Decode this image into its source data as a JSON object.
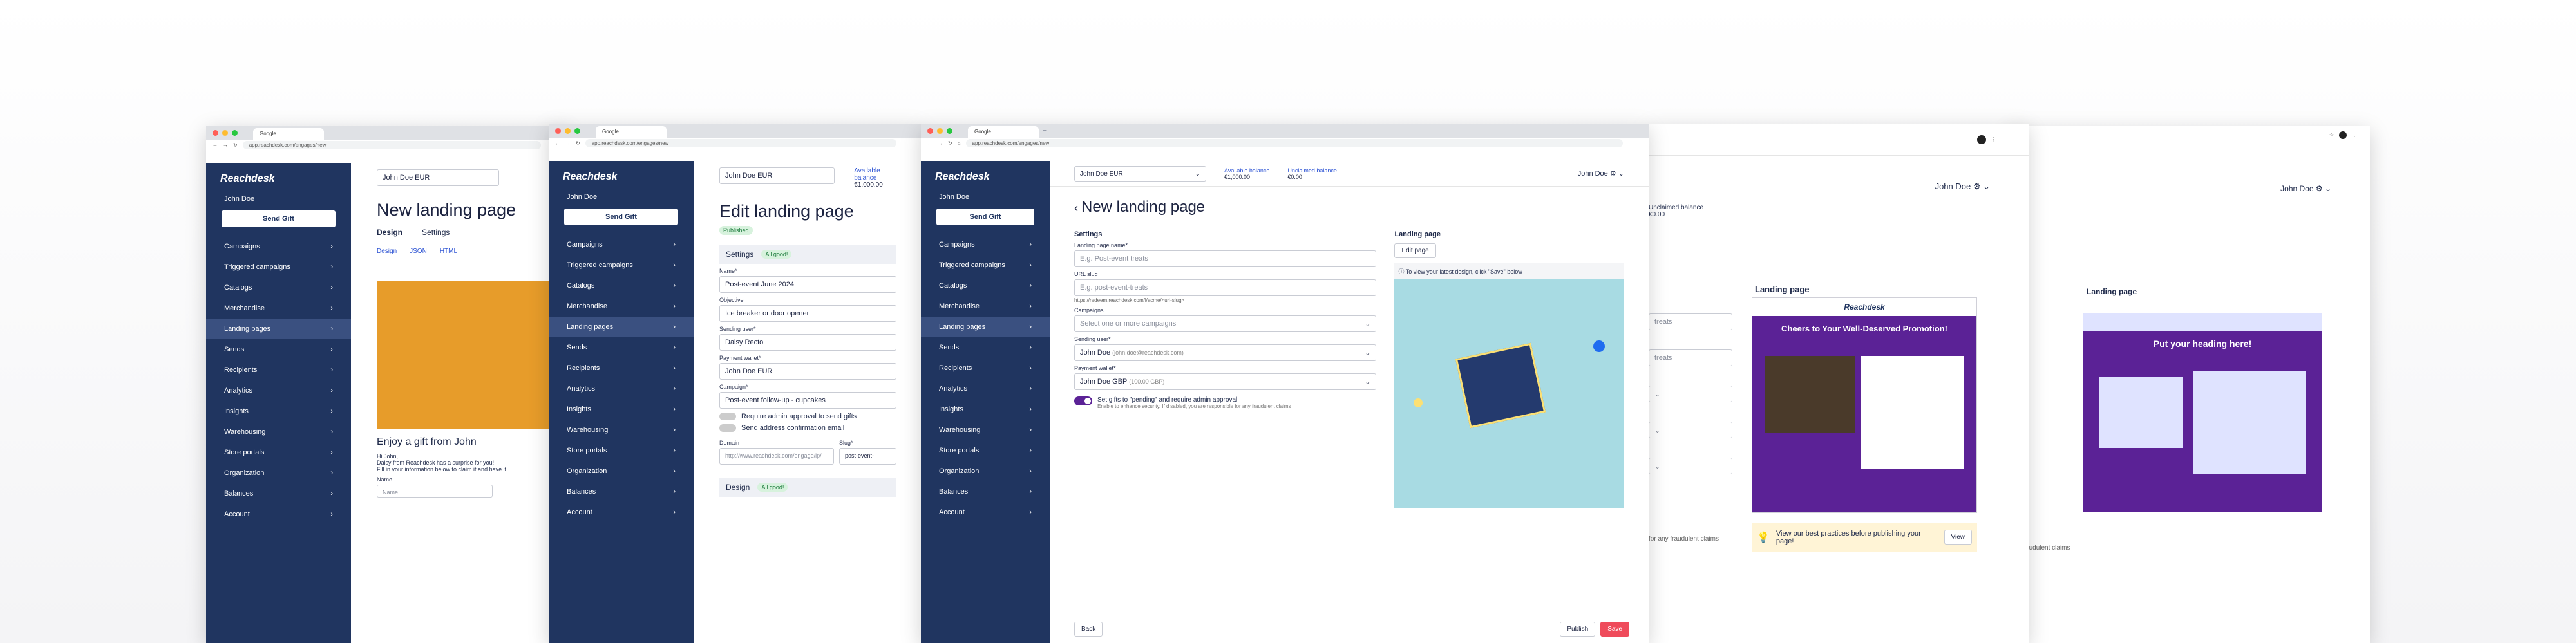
{
  "browser": {
    "tab_title": "Google",
    "url_new": "app.reachdesk.com/engages/new"
  },
  "sidebar": {
    "logo": "Reachdesk",
    "user": "John Doe",
    "send_gift": "Send Gift",
    "items": [
      {
        "label": "Campaigns"
      },
      {
        "label": "Triggered campaigns"
      },
      {
        "label": "Catalogs"
      },
      {
        "label": "Merchandise"
      },
      {
        "label": "Landing pages"
      },
      {
        "label": "Sends"
      },
      {
        "label": "Recipients"
      },
      {
        "label": "Analytics"
      },
      {
        "label": "Insights"
      },
      {
        "label": "Warehousing"
      },
      {
        "label": "Store portals"
      },
      {
        "label": "Organization"
      },
      {
        "label": "Balances"
      },
      {
        "label": "Account"
      }
    ]
  },
  "left1": {
    "select": "John Doe EUR",
    "title": "New landing page",
    "tab_design": "Design",
    "tab_settings": "Settings",
    "greeting": "Enjoy a gift from John",
    "hi": "Hi John,",
    "body1": "Daisy from Reachdesk has a surprise for you!",
    "body2": "Fill in your information below to claim it and have it",
    "name_label": "Name",
    "name_ph": "Name",
    "json": "JSON",
    "html": "HTML",
    "design_link": "Design"
  },
  "left2": {
    "select": "John Doe EUR",
    "title": "Edit landing page",
    "status": "Published",
    "settings": "Settings",
    "all_good": "All good!",
    "available": "Available balance",
    "available_amt": "€1,000.00",
    "name_label": "Name*",
    "name_val": "Post-event June 2024",
    "objective_label": "Objective",
    "objective_val": "Ice breaker or door opener",
    "sending_label": "Sending user*",
    "sending_val": "Daisy Recto",
    "payment_label": "Payment wallet*",
    "payment_val": "John Doe EUR",
    "campaign_label": "Campaign*",
    "campaign_val": "Post-event follow-up - cupcakes",
    "admin": "Require admin approval to send gifts",
    "address": "Send address confirmation email",
    "domain_label": "Domain",
    "domain_val": "http://www.reachdesk.com/engage/lp/",
    "slug_label": "Slug*",
    "slug_val": "post-event-",
    "design": "Design"
  },
  "center": {
    "wallet": "John Doe EUR",
    "avail_label": "Available balance",
    "avail_amt": "€1,000.00",
    "unclaimed_label": "Unclaimed balance",
    "unclaimed_amt": "€0.00",
    "user": "John Doe",
    "title": "New landing page",
    "settings": "Settings",
    "landing_page": "Landing page",
    "name_label": "Landing page name*",
    "name_ph": "E.g. Post-event treats",
    "url_label": "URL slug",
    "url_ph": "E.g. post-event-treats",
    "url_hint": "https://redeem.reachdesk.com/l/acme/<url-slug>",
    "campaigns_label": "Campaigns",
    "campaigns_ph": "Select one or more campaigns",
    "sending_label": "Sending user*",
    "sending_val": "John Doe",
    "sending_email": "(john.doe@reachdesk.com)",
    "payment_label": "Payment wallet*",
    "payment_val": "John Doe GBP",
    "payment_amt": "(100.00 GBP)",
    "toggle_label": "Set gifts to \"pending\" and require admin approval",
    "toggle_hint": "Enable to enhance security. If disabled, you are responsible for any fraudulent claims",
    "edit_page": "Edit page",
    "info": "To view your latest design, click \"Save\" below",
    "back": "Back",
    "publish": "Publish",
    "save": "Save"
  },
  "right1": {
    "user": "John Doe",
    "unclaimed_label": "Unclaimed balance",
    "unclaimed_amt": "€0.00",
    "landing_page": "Landing page",
    "logo": "Reachdesk",
    "headline": "Cheers to Your Well-Deserved Promotion!",
    "tip": "View our best practices before publishing your page!",
    "view": "View",
    "fraud": "for any fraudulent claims",
    "treats1": "treats",
    "treats2": "treats"
  },
  "right2": {
    "user": "John Doe",
    "landing_page": "Landing page",
    "headline": "Put your heading here!",
    "fraud": "any fraudulent claims"
  }
}
